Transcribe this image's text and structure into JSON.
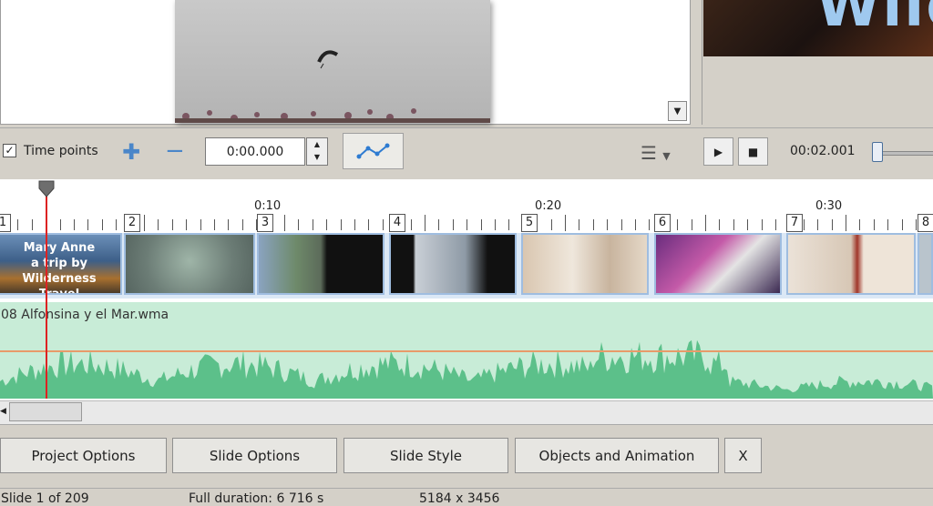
{
  "toolbar": {
    "time_points_label": "Time points",
    "time_value": "0:00.000",
    "time_readout": "00:02.001"
  },
  "ruler": {
    "labels": [
      "0:10",
      "0:20",
      "0:30"
    ]
  },
  "slides": [
    {
      "number": "1",
      "text": "Mary Anne a trip by Wilderness Travel"
    },
    {
      "number": "2",
      "text": ""
    },
    {
      "number": "3",
      "text": ""
    },
    {
      "number": "4",
      "text": ""
    },
    {
      "number": "5",
      "text": ""
    },
    {
      "number": "6",
      "text": ""
    },
    {
      "number": "7",
      "text": ""
    },
    {
      "number": "8",
      "text": ""
    }
  ],
  "slide1": {
    "line1": "Mary Anne",
    "line2": "a trip by",
    "line3": "Wilderness Travel"
  },
  "audio": {
    "filename": "08 Alfonsina y el Mar.wma"
  },
  "preview_title_fragment": "Wild",
  "buttons": {
    "project_options": "Project Options",
    "slide_options": "Slide Options",
    "slide_style": "Slide Style",
    "objects_and_animation": "Objects and Animation",
    "close": "X"
  },
  "status": {
    "slide": "Slide 1 of 209",
    "duration": "Full duration: 6 716 s",
    "size": "5184 x 3456"
  },
  "colors": {
    "audio_wave": "#5cc08a",
    "audio_bg": "#c8ecd7",
    "playhead": "#dd2222",
    "slide_border": "#9fbde0"
  }
}
